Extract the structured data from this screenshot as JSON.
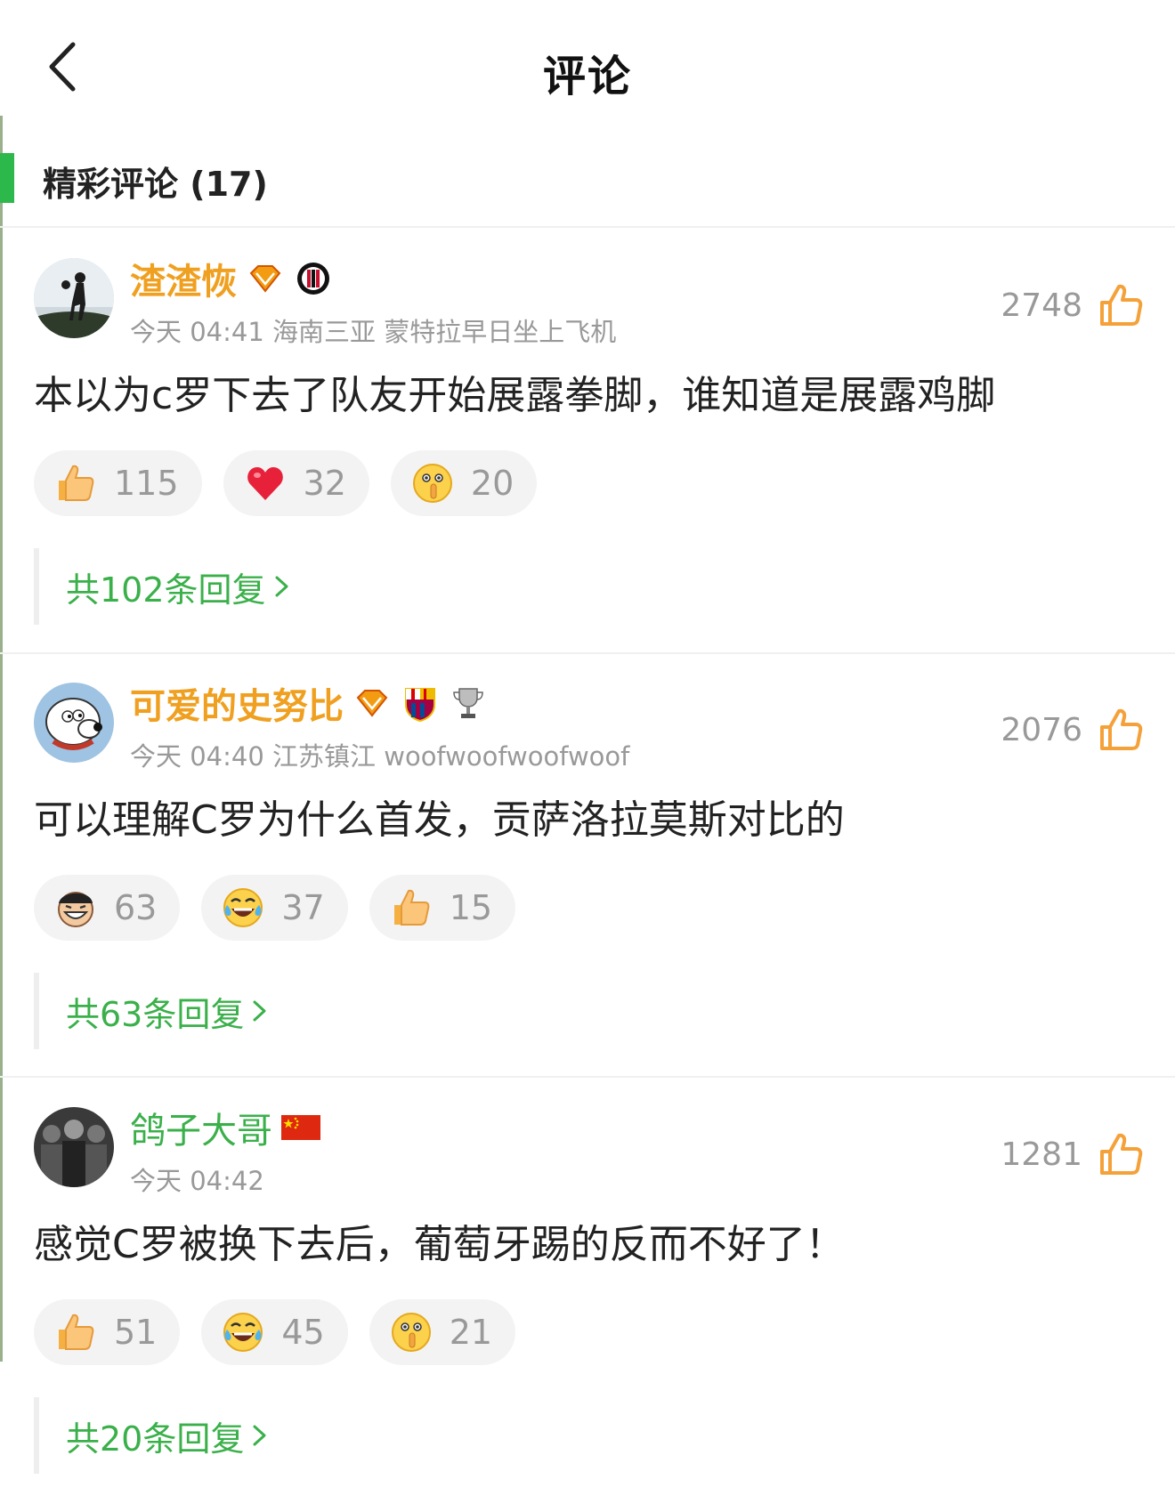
{
  "header": {
    "title": "评论",
    "back_icon": "chevron-left-icon"
  },
  "section": {
    "title": "精彩评论 (17)",
    "accent_color": "#2db84b"
  },
  "colors": {
    "vip_nick": "#f0a020",
    "green": "#3ab04a",
    "meta": "#999999"
  },
  "comments": [
    {
      "nick": "渣渣恢",
      "badges": [
        "vip-diamond-icon",
        "ac-milan-badge-icon"
      ],
      "meta": "今天 04:41 海南三亚 蒙特拉早日坐上飞机",
      "likes": "2748",
      "text": "本以为c罗下去了队友开始展露拳脚，谁知道是展露鸡脚",
      "reactions": [
        {
          "icon": "thumbs-up-emoji-icon",
          "count": "115"
        },
        {
          "icon": "red-heart-emoji-icon",
          "count": "32"
        },
        {
          "icon": "shush-emoji-icon",
          "count": "20"
        }
      ],
      "replies": "共102条回复"
    },
    {
      "nick": "可爱的史努比",
      "badges": [
        "vip-diamond-icon",
        "barcelona-badge-icon",
        "trophy-icon"
      ],
      "meta": "今天 04:40 江苏镇江 woofwoofwoofwoof",
      "likes": "2076",
      "text": "可以理解C罗为什么首发，贡萨洛拉莫斯对比的",
      "reactions": [
        {
          "icon": "laughing-man-emoji-icon",
          "count": "63"
        },
        {
          "icon": "tears-of-joy-emoji-icon",
          "count": "37"
        },
        {
          "icon": "thumbs-up-emoji-icon",
          "count": "15"
        }
      ],
      "replies": "共63条回复"
    },
    {
      "nick": "鸽子大哥",
      "badges": [
        "china-flag-icon"
      ],
      "meta": "今天 04:42",
      "likes": "1281",
      "text": "感觉C罗被换下去后，葡萄牙踢的反而不好了！",
      "reactions": [
        {
          "icon": "thumbs-up-emoji-icon",
          "count": "51"
        },
        {
          "icon": "tears-of-joy-emoji-icon",
          "count": "45"
        },
        {
          "icon": "shush-emoji-icon",
          "count": "21"
        }
      ],
      "replies": "共20条回复"
    }
  ]
}
